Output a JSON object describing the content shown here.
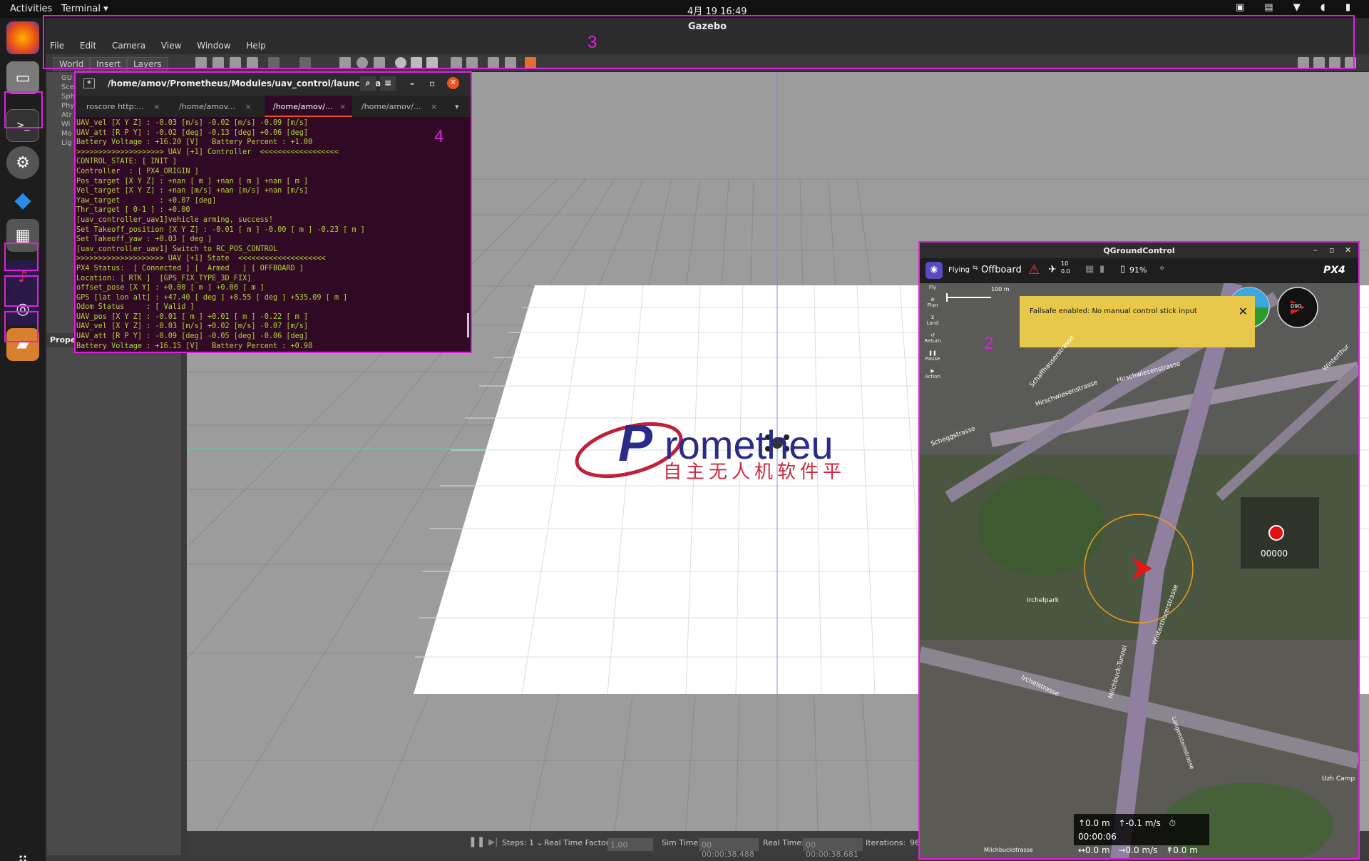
{
  "topbar": {
    "activities": "Activities",
    "app_menu": "Terminal ▾",
    "clock": "4月 19 16:49"
  },
  "gazebo": {
    "title": "Gazebo",
    "menu": [
      "File",
      "Edit",
      "Camera",
      "View",
      "Window",
      "Help"
    ],
    "tabs": [
      "World",
      "Insert",
      "Layers"
    ],
    "left_tree": [
      "GU",
      "Sce",
      "Sph",
      "Phy",
      "Atr",
      "Wi",
      "Mo",
      "Lig"
    ],
    "properties_label": "Prope",
    "logo_text": "rometheu",
    "logo_letter": "P",
    "logo_cn": "自主无人机软件平",
    "bottom": {
      "steps_label": "Steps:",
      "steps_value": "1 ⌄",
      "rtf_label": "Real Time Factor:",
      "rtf_value": "1.00",
      "sim_label": "Sim Time:",
      "sim_value": "00 00:00:38.488",
      "real_label": "Real Time:",
      "real_value": "00 00:00:38.681",
      "iter_label": "Iterations:",
      "iter_value": "96"
    }
  },
  "terminal": {
    "title": "/home/amov/Prometheus/Modules/uav_control/launch/uav...",
    "tabs": [
      "roscore http:...",
      "/home/amov...",
      "/home/amov/...",
      "/home/amov/..."
    ],
    "lines": [
      "UAV_vel [X Y Z] : -0.03 [m/s] -0.02 [m/s] -0.09 [m/s]",
      "UAV_att [R P Y] : -0.02 [deg] -0.13 [deg] +0.06 [deg]",
      "Battery Voltage : +16.20 [V]   Battery Percent : +1.00",
      ">>>>>>>>>>>>>>>>>>>> UAV [+1] Controller  <<<<<<<<<<<<<<<<<<",
      "CONTROL_STATE: [ INIT ]",
      "Controller  : [ PX4_ORIGIN ]",
      "Pos_target [X Y Z] : +nan [ m ] +nan [ m ] +nan [ m ]",
      "Vel_target [X Y Z] : +nan [m/s] +nan [m/s] +nan [m/s]",
      "Yaw_target         : +0.07 [deg]",
      "Thr_target [ 0-1 ] : +0.00",
      "[uav_controller_uav1]vehicle arming, success!",
      "Set Takeoff_position [X Y Z] : -0.01 [ m ] -0.00 [ m ] -0.23 [ m ]",
      "Set Takeoff_yaw : +0.03 [ deg ]",
      "[uav_controller_uav1] Switch to RC_POS_CONTROL",
      ">>>>>>>>>>>>>>>>>>>> UAV [+1] State  <<<<<<<<<<<<<<<<<<<<",
      "PX4 Status:  [ Connected ] [  Armed   ] [ OFFBOARD ]",
      "Location: [ RTK ]  [GPS_FIX_TYPE_3D_FIX]",
      "offset_pose [X Y] : +0.00 [ m ] +0.00 [ m ]",
      "GPS [lat lon alt] : +47.40 [ deg ] +8.55 [ deg ] +535.09 [ m ]",
      "Odom Status     : [ Valid ]",
      "UAV_pos [X Y Z] : -0.01 [ m ] +0.01 [ m ] -0.22 [ m ]",
      "UAV_vel [X Y Z] : -0.03 [m/s] +0.02 [m/s] -0.07 [m/s]",
      "UAV_att [R P Y] : -0.09 [deg] -0.05 [deg] -0.06 [deg]",
      "Battery Voltage : +16.15 [V]   Battery Percent : +0.98"
    ]
  },
  "qgc": {
    "title": "QGroundControl",
    "flight_state": "Flying",
    "mode": "Offboard",
    "sat_count": "10",
    "sat_hdop": "0.0",
    "battery": "91%",
    "brand": "PX4",
    "scale": "100 m",
    "failsafe": "Failsafe enabled: No manual control stick input",
    "fly_tools": [
      "Fly",
      "Plan",
      "Land",
      "Return",
      "Pause",
      "Action"
    ],
    "compass_heading": "090",
    "record_counter": "00000",
    "map_labels": [
      "Schaffhauserstrasse",
      "Hirschwiesenstrasse",
      "Hirschwiesenstrasse",
      "Irchelpark",
      "Irchelstrasse",
      "Milchbuck-Tunnel",
      "Winterthurerstrasse",
      "Scheggstrasse",
      "Winterthur",
      "Uzh Camp",
      "Milchbuckstrasse",
      "Langensteinstrasse"
    ],
    "telemetry": {
      "alt": "↑0.0 m",
      "vspeed": "↑-0.1 m/s",
      "time": "⏱00:00:06",
      "dist": "↔0.0 m",
      "hspeed": "→0.0 m/s",
      "home": "↟0.0 m"
    }
  },
  "annotations": [
    "3",
    "4",
    "2"
  ]
}
